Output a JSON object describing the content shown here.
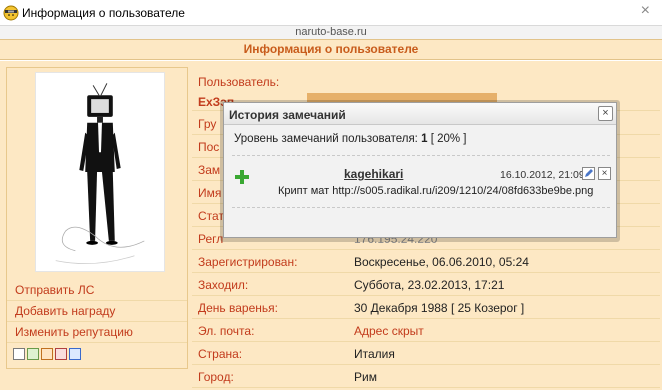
{
  "window": {
    "title": "Информация о пользователе",
    "close_glyph": "×"
  },
  "site": "naruto-base.ru",
  "page_header": "Информация о пользователе",
  "left": {
    "actions": [
      {
        "label": "Отправить ЛС"
      },
      {
        "label": "Добавить награду"
      },
      {
        "label": "Изменить репутацию"
      }
    ]
  },
  "profile": {
    "user_label": "Пользователь:",
    "username": "ExЗэп",
    "rows": [
      {
        "label": "Гру",
        "value": ""
      },
      {
        "label": "Пос",
        "value": ""
      },
      {
        "label": "Зам",
        "value": ""
      },
      {
        "label": "Имя",
        "value": ""
      },
      {
        "label": "Стат",
        "value": ""
      },
      {
        "label": "Регл",
        "value": "176.195.24.220"
      },
      {
        "label": "Зарегистрирован:",
        "value": "Воскресенье, 06.06.2010, 05:24"
      },
      {
        "label": "Заходил:",
        "value": "Суббота, 23.02.2013, 17:21"
      },
      {
        "label": "День варенья:",
        "value": "30 Декабря 1988 [ 25 Козерог ]"
      },
      {
        "label": "Эл. почта:",
        "value": "Адрес скрыт"
      },
      {
        "label": "Страна:",
        "value": "Италия"
      },
      {
        "label": "Город:",
        "value": "Рим"
      }
    ]
  },
  "modal": {
    "title": "История замечаний",
    "close_glyph": "×",
    "level_label": "Уровень замечаний пользователя:",
    "level_value": "1",
    "level_percent": "[ 20% ]",
    "entries": [
      {
        "author": "kagehikari",
        "date": "16.10.2012, 21:09",
        "reason": "Крипт мат http://s005.radikal.ru/i209/1210/24/08fd633be9be.png",
        "delete_glyph": "×"
      }
    ]
  },
  "colors": {
    "accent": "#c23b1c",
    "background": "#fde8c4",
    "border": "#e2c38a"
  }
}
